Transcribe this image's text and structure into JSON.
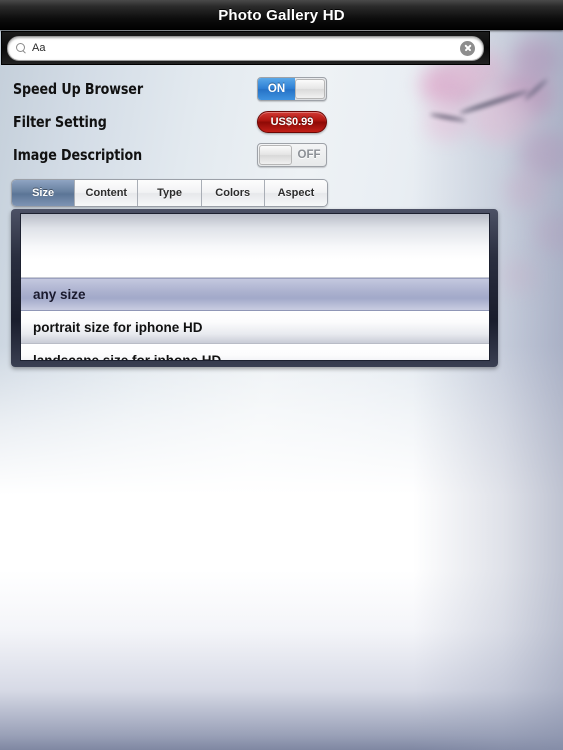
{
  "window": {
    "title": "Photo Gallery HD"
  },
  "search": {
    "value": "Aa",
    "icon": "search-icon",
    "clear_icon": "clear-circle-x-icon"
  },
  "settings": [
    {
      "label": "Speed Up Browser",
      "control": "toggle",
      "state": "ON",
      "state_label": "ON"
    },
    {
      "label": "Filter Setting",
      "control": "price-button",
      "price_label": "US$0.99"
    },
    {
      "label": "Image Description",
      "control": "toggle",
      "state": "OFF",
      "state_label": "OFF"
    }
  ],
  "tabs": [
    {
      "label": "Size",
      "active": true
    },
    {
      "label": "Content",
      "active": false
    },
    {
      "label": "Type",
      "active": false
    },
    {
      "label": "Colors",
      "active": false
    },
    {
      "label": "Aspect",
      "active": false
    }
  ],
  "option_list": {
    "rows": [
      {
        "label": "any size",
        "selected": true
      },
      {
        "label": "portrait size for iphone HD",
        "selected": false
      },
      {
        "label": "landscape size for iphone HD",
        "selected": false
      }
    ]
  },
  "colors": {
    "titlebar": "#000000",
    "toggle_on": "#2e7fd4",
    "price_button": "#b31812",
    "tab_active": "#667f9f",
    "row_selected": "#adb3d0",
    "page_bottom": "#7f87a2"
  }
}
